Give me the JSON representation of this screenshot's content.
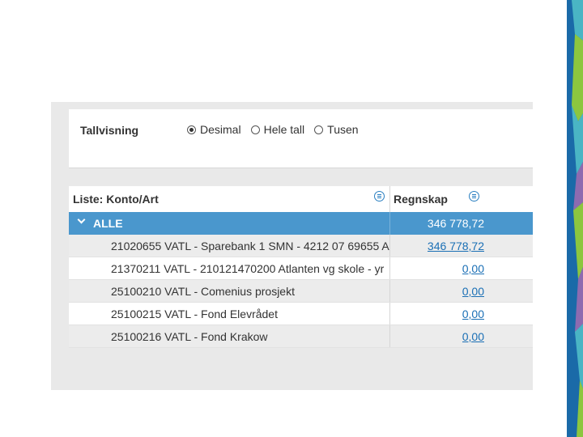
{
  "settings": {
    "label": "Tallvisning",
    "options": [
      {
        "label": "Desimal",
        "checked": true
      },
      {
        "label": "Hele tall",
        "checked": false
      },
      {
        "label": "Tusen",
        "checked": false
      }
    ]
  },
  "table": {
    "col1_header": "Liste: Konto/Art",
    "col2_header": "Regnskap",
    "total": {
      "label": "ALLE",
      "value": "346 778,72"
    },
    "rows": [
      {
        "label": "21020655 VATL - Sparebank 1 SMN - 4212 07 69655 A",
        "value": "346 778,72"
      },
      {
        "label": "21370211 VATL - 210121470200 Atlanten vg skole - yr",
        "value": "0,00"
      },
      {
        "label": "25100210 VATL - Comenius prosjekt",
        "value": "0,00"
      },
      {
        "label": "25100215 VATL - Fond Elevrådet",
        "value": "0,00"
      },
      {
        "label": "25100216 VATL - Fond Krakow",
        "value": "0,00"
      }
    ]
  },
  "colors": {
    "accent": "#4a97cd",
    "link": "#1a6fb5",
    "stripe_dark_blue": "#1a6aa8",
    "stripe_green": "#8cc63f",
    "stripe_purple": "#8e6bb0",
    "stripe_teal": "#4ab5c4"
  }
}
